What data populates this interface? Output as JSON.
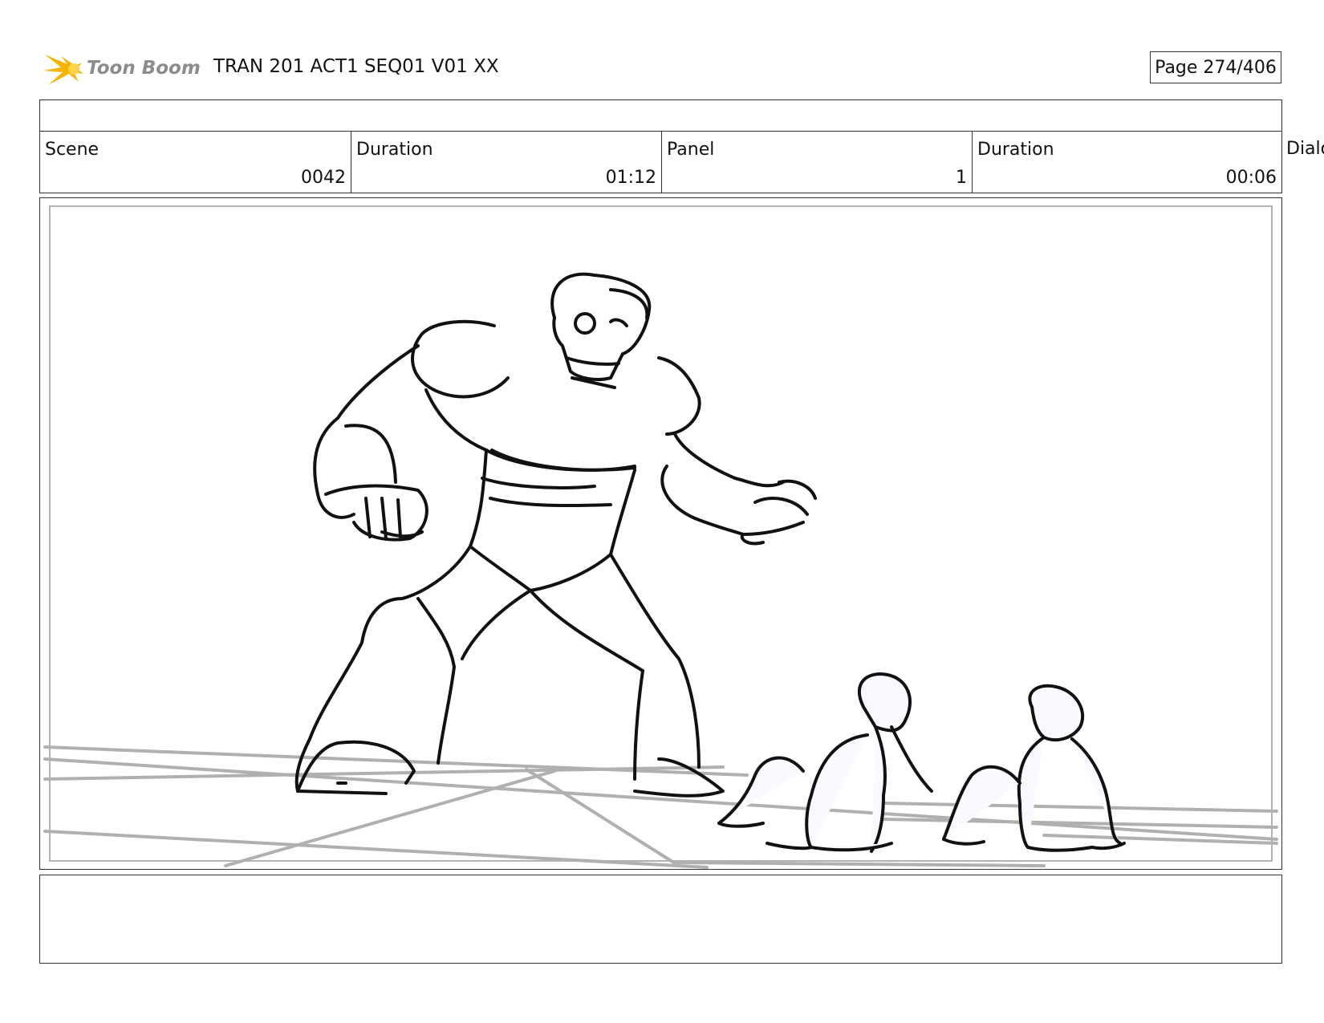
{
  "header": {
    "logo_text": "Toon Boom",
    "title": "TRAN 201 ACT1 SEQ01 V01 XX",
    "page": "Page 274/406"
  },
  "info": {
    "scene_label": "Scene",
    "scene_value": "0042",
    "scene_duration_label": "Duration",
    "scene_duration_value": "01:12",
    "panel_label": "Panel",
    "panel_value": "1",
    "panel_duration_label": "Duration",
    "panel_duration_value": "00:06",
    "dialog_label": "Dialo"
  },
  "colors": {
    "logo_orange": "#f5b400",
    "logo_gray": "#8c8c8c",
    "sketch_line": "#111111",
    "guide_line": "#b0b0b0"
  }
}
